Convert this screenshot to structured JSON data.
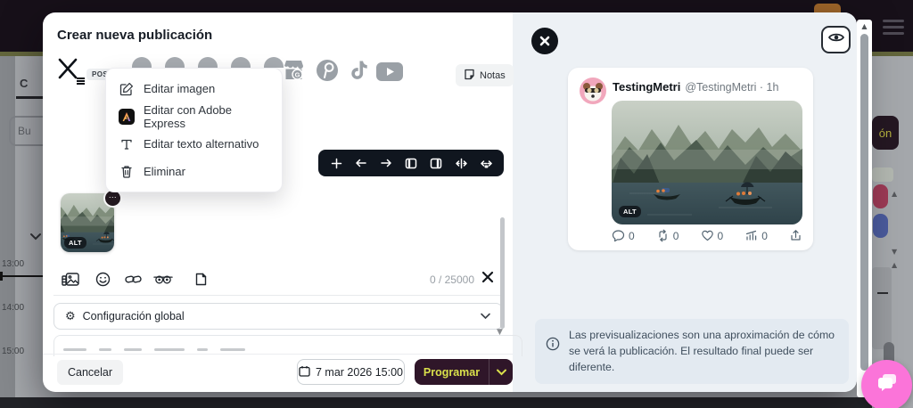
{
  "modal": {
    "title": "Crear nueva publicación",
    "network_badge": "POST",
    "notes_label": "Notas",
    "menu": {
      "items": [
        {
          "icon": "edit-image-icon",
          "label": "Editar imagen"
        },
        {
          "icon": "adobe-express-icon",
          "label": "Editar con Adobe Express"
        },
        {
          "icon": "alt-text-icon",
          "label": "Editar texto alternativo"
        },
        {
          "icon": "trash-icon",
          "label": "Eliminar"
        }
      ]
    },
    "media": {
      "alt_badge": "ALT"
    },
    "char_counter": "0 / 25000",
    "global_settings_label": "Configuración global",
    "footer": {
      "cancel_label": "Cancelar",
      "datetime_value": "7 mar 2026 15:00",
      "schedule_label": "Programar"
    }
  },
  "preview": {
    "account": {
      "name": "TestingMetri",
      "meta": "@TestingMetri · 1h"
    },
    "alt_badge": "ALT",
    "stats": [
      {
        "name": "replies",
        "value": "0"
      },
      {
        "name": "reposts",
        "value": "0"
      },
      {
        "name": "likes",
        "value": "0"
      },
      {
        "name": "views",
        "value": "0"
      }
    ],
    "disclaimer": "Las previsualizaciones son una aproximación de cómo se verá la publicación. El resultado final puede ser diferente."
  },
  "background": {
    "tab_label": "C",
    "search_value": "Bu",
    "times": [
      "13:00",
      "14:00",
      "15:00"
    ],
    "cut_button_label": "ón"
  },
  "icons": {
    "more": "⋯",
    "gear": "⚙",
    "arrow_up": "▲",
    "arrow_down": "▼"
  },
  "colors": {
    "accent_yellow": "#d9e04b",
    "schedule_button_bg": "#2f1629",
    "chat_bubble_pink": "#fb74d9",
    "note_bg": "#e3eaf1",
    "toolbar_bg": "#10161f"
  }
}
